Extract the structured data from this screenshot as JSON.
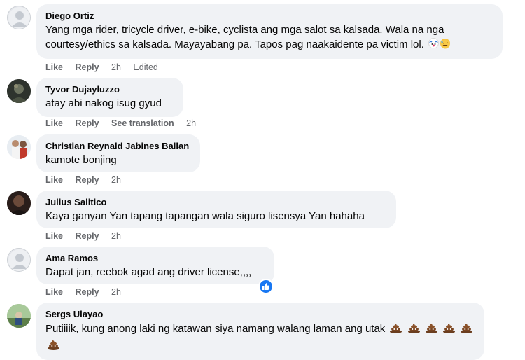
{
  "comments": [
    {
      "name": "Diego Ortiz",
      "text": "Yang mga rider, tricycle driver, e-bike, cyclista ang mga salot sa kalsada. Wala na nga courtesy/ethics sa kalsada. Mayayabang pa. Tapos pag naakaidente pa victim lol.",
      "like": "Like",
      "reply": "Reply",
      "time": "2h",
      "edited": "Edited",
      "emojis": [
        "clown-face-icon",
        "rolling-laughing-icon"
      ]
    },
    {
      "name": "Tyvor Dujayluzzo",
      "text": "atay abi nakog isug gyud",
      "like": "Like",
      "reply": "Reply",
      "translate": "See translation",
      "time": "2h"
    },
    {
      "name": "Christian Reynald Jabines Ballan",
      "text": "kamote bonjing",
      "like": "Like",
      "reply": "Reply",
      "time": "2h"
    },
    {
      "name": "Julius Salitico",
      "text": "Kaya ganyan Yan tapang tapangan wala siguro lisensya Yan hahaha",
      "like": "Like",
      "reply": "Reply",
      "time": "2h"
    },
    {
      "name": "Ama Ramos",
      "text": "Dapat jan, reebok agad ang driver license,,,,",
      "like": "Like",
      "reply": "Reply",
      "time": "2h",
      "reaction": "like-reaction-icon"
    },
    {
      "name": "Sergs Ulayao",
      "text": "Putiiiik, kung anong laki ng katawan siya namang walang laman ang utak",
      "emojis": [
        "poop-icon",
        "poop-icon",
        "poop-icon",
        "poop-icon",
        "poop-icon",
        "poop-icon"
      ]
    }
  ],
  "colors": {
    "bubble": "#f0f2f5",
    "meta": "#65676b",
    "text": "#050505",
    "like_blue": "#1877f2"
  }
}
